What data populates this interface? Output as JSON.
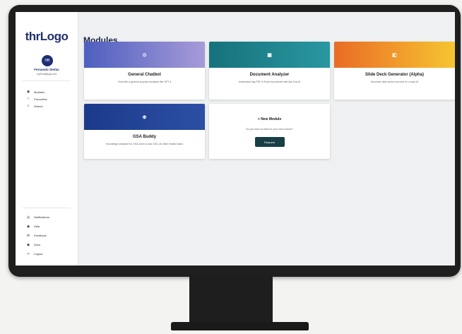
{
  "brand": {
    "logo_text": "thrLogo"
  },
  "user": {
    "initials": "HB",
    "name": "Fernando Stefan",
    "email": "myEmail@gov.net"
  },
  "nav_primary": [
    {
      "label": "Modules",
      "icon": "modules-icon",
      "glyph": "◉"
    },
    {
      "label": "Favourites",
      "icon": "favorites-icon",
      "glyph": "☆"
    },
    {
      "label": "Search",
      "icon": "search-icon",
      "glyph": "⌕"
    }
  ],
  "nav_secondary": [
    {
      "label": "Notifications",
      "icon": "bell-icon",
      "glyph": "◎"
    },
    {
      "label": "Help",
      "icon": "help-icon",
      "glyph": "◉"
    },
    {
      "label": "Feedback",
      "icon": "feedback-icon",
      "glyph": "✉"
    },
    {
      "label": "Docs",
      "icon": "docs-icon",
      "glyph": "◆"
    },
    {
      "label": "Logout",
      "icon": "logout-icon",
      "glyph": "⇦"
    }
  ],
  "page": {
    "title": "Modules"
  },
  "modules": [
    {
      "title": "General Chatbot",
      "description": "Chat with a general purpose assistant like GPT-4",
      "icon": "chat-icon",
      "glyph": "⊙",
      "gradient": [
        "#4d5fbf",
        "#a79ad8"
      ]
    },
    {
      "title": "Document Analyzer",
      "description": "Understand big PDF & Excel documents with Ask Doc AI",
      "icon": "document-icon",
      "glyph": "▣",
      "gradient": [
        "#16727c",
        "#2a97a1"
      ]
    },
    {
      "title": "Slide Deck Generator (Alpha)",
      "description": "Generate slide decks from text on a topic AI",
      "icon": "slides-icon",
      "glyph": "◧",
      "gradient": [
        "#ea6b25",
        "#f6c531"
      ]
    },
    {
      "title": "GSA Buddy",
      "description": "Knowledge assistant for GSA users to ask GSA, all office related tasks",
      "icon": "buddy-icon",
      "glyph": "⊕",
      "gradient": [
        "#1c3a8a",
        "#2c4fa5"
      ]
    }
  ],
  "new_module": {
    "title": "New Module",
    "description": "Do you have an idea for your own module?",
    "button_label": "Request"
  },
  "colors": {
    "accent": "#1e2f73",
    "button": "#173f45"
  }
}
